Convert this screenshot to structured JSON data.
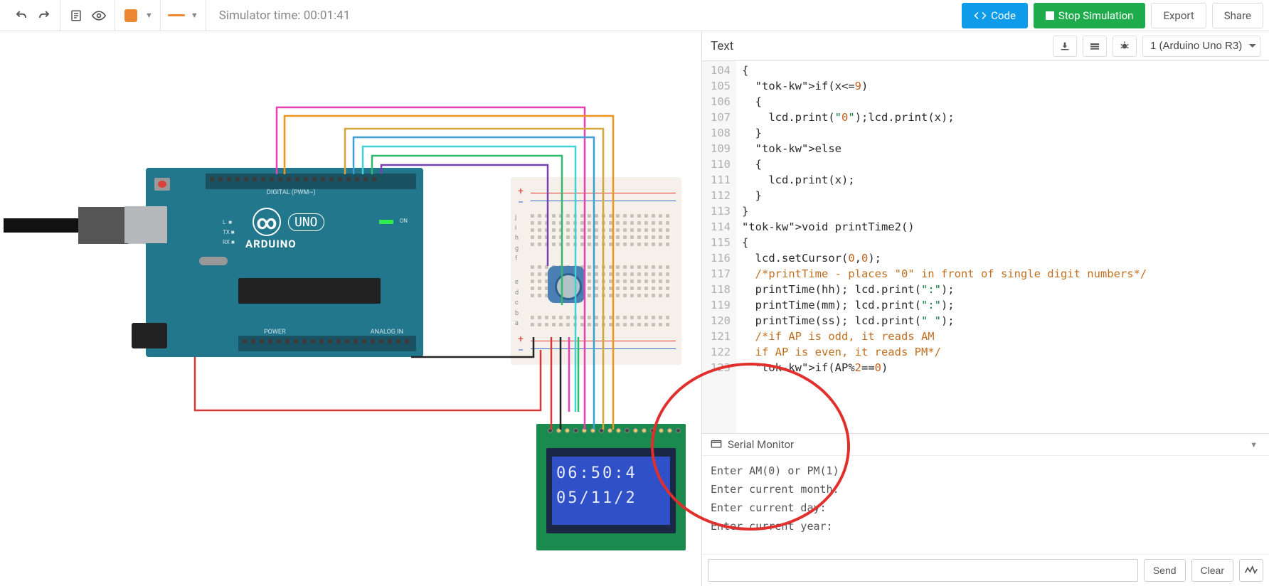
{
  "toolbar": {
    "sim_time": "Simulator time: 00:01:41",
    "code_btn": "Code",
    "stop_btn": "Stop Simulation",
    "export_btn": "Export",
    "share_btn": "Share"
  },
  "arduino": {
    "brand": "ARDUINO",
    "model": "UNO",
    "digital_label": "DIGITAL (PWM~)",
    "power_label": "POWER",
    "analog_label": "ANALOG IN",
    "on_label": "ON",
    "tx_label": "TX",
    "rx_label": "RX",
    "l_label": "L"
  },
  "lcd": {
    "line1": "06:50:4",
    "line2": "05/11/2"
  },
  "code_panel": {
    "title": "Text",
    "board": "1 (Arduino Uno R3)",
    "lines": [
      {
        "n": "104",
        "c": "{"
      },
      {
        "n": "105",
        "c": "  if(x<=9)",
        "kw": [
          "if"
        ]
      },
      {
        "n": "106",
        "c": "  {"
      },
      {
        "n": "107",
        "c": "    lcd.print(\"0\");lcd.print(x);"
      },
      {
        "n": "108",
        "c": "  }"
      },
      {
        "n": "109",
        "c": "  else",
        "kw": [
          "else"
        ]
      },
      {
        "n": "110",
        "c": "  {"
      },
      {
        "n": "111",
        "c": "    lcd.print(x);"
      },
      {
        "n": "112",
        "c": "  }"
      },
      {
        "n": "113",
        "c": "}"
      },
      {
        "n": "114",
        "c": "void printTime2()",
        "kw": [
          "void"
        ]
      },
      {
        "n": "115",
        "c": "{"
      },
      {
        "n": "116",
        "c": "  lcd.setCursor(0,0);"
      },
      {
        "n": "117",
        "c": "  /*printTime - places \"0\" in front of single digit numbers*/",
        "cm": true
      },
      {
        "n": "118",
        "c": "  printTime(hh); lcd.print(\":\");"
      },
      {
        "n": "119",
        "c": "  printTime(mm); lcd.print(\":\");"
      },
      {
        "n": "120",
        "c": "  printTime(ss); lcd.print(\" \");"
      },
      {
        "n": "121",
        "c": "  /*if AP is odd, it reads AM",
        "cm": true
      },
      {
        "n": "122",
        "c": "  if AP is even, it reads PM*/",
        "cm": true
      },
      {
        "n": "123",
        "c": "  if(AP%2==0)",
        "kw": [
          "if"
        ]
      }
    ]
  },
  "serial": {
    "title": "Serial Monitor",
    "output": [
      "Enter AM(0) or PM(1)",
      "Enter current month:",
      "Enter current day:",
      "Enter current year:"
    ],
    "send_btn": "Send",
    "clear_btn": "Clear"
  }
}
